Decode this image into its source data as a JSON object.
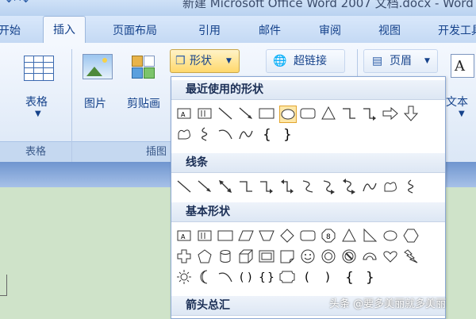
{
  "window": {
    "title": "新建 Microsoft Office Word 2007 文档.docx - Word"
  },
  "tabs": [
    {
      "label": "开始"
    },
    {
      "label": "插入"
    },
    {
      "label": "页面布局"
    },
    {
      "label": "引用"
    },
    {
      "label": "邮件"
    },
    {
      "label": "审阅"
    },
    {
      "label": "视图"
    },
    {
      "label": "开发工具"
    }
  ],
  "ribbon": {
    "table_label": "表格",
    "table_group": "表格",
    "picture_label": "图片",
    "clipart_label": "剪贴画",
    "shapes_label": "形状",
    "hyperlink_label": "超链接",
    "header_label": "页眉",
    "textbox_label": "文本",
    "illustrations_group": "插图"
  },
  "dropdown": {
    "recent_title": "最近使用的形状",
    "lines_title": "线条",
    "basic_title": "基本形状",
    "arrows_title": "箭头总汇"
  },
  "watermark": "头条 @要多美丽就多美丽"
}
